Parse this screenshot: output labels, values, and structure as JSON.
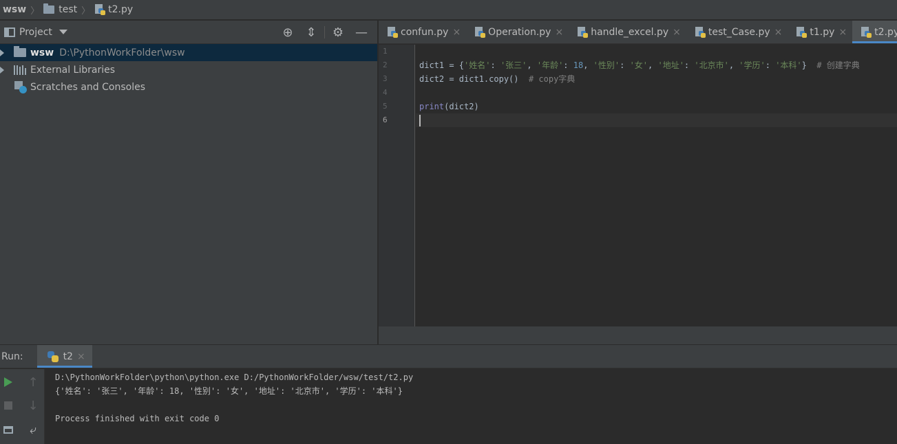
{
  "breadcrumb": {
    "root": "wsw",
    "folder": "test",
    "file": "t2.py"
  },
  "project": {
    "title": "Project",
    "tree": [
      {
        "name": "wsw",
        "path": "D:\\PythonWorkFolder\\wsw"
      },
      {
        "name": "External Libraries"
      },
      {
        "name": "Scratches and Consoles"
      }
    ]
  },
  "tabs": [
    {
      "label": "confun.py"
    },
    {
      "label": "Operation.py"
    },
    {
      "label": "handle_excel.py"
    },
    {
      "label": "test_Case.py"
    },
    {
      "label": "t1.py"
    },
    {
      "label": "t2.py",
      "active": true
    }
  ],
  "editor": {
    "line_numbers": [
      "1",
      "2",
      "3",
      "4",
      "5",
      "6"
    ],
    "line2": {
      "p1": "dict1 = {",
      "k1": "'姓名'",
      "p2": ": ",
      "v1": "'张三'",
      "p3": ", ",
      "k2": "'年龄'",
      "p4": ": ",
      "v2": "18",
      "p5": ", ",
      "k3": "'性别'",
      "p6": ": ",
      "v3": "'女'",
      "p7": ", ",
      "k4": "'地址'",
      "p8": ": ",
      "v4": "'北京市'",
      "p9": ", ",
      "k5": "'学历'",
      "p10": ": ",
      "v5": "'本科'",
      "p11": "}  ",
      "comment": "# 创建字典"
    },
    "line3": {
      "code": "dict2 = dict1.copy()  ",
      "comment": "# copy字典"
    },
    "line5": {
      "builtin": "print",
      "rest": "(dict2)"
    }
  },
  "run": {
    "label": "Run:",
    "tab": "t2",
    "output": [
      "D:\\PythonWorkFolder\\python\\python.exe D:/PythonWorkFolder/wsw/test/t2.py",
      "{'姓名': '张三', '年龄': 18, '性别': '女', '地址': '北京市', '学历': '本科'}",
      "",
      "Process finished with exit code 0"
    ]
  },
  "icons": {
    "close": "×",
    "locate": "⊕",
    "collapse": "⇕",
    "settings": "⚙",
    "hide": "—",
    "up": "↑",
    "down": "↓",
    "wrap": "⤶"
  }
}
